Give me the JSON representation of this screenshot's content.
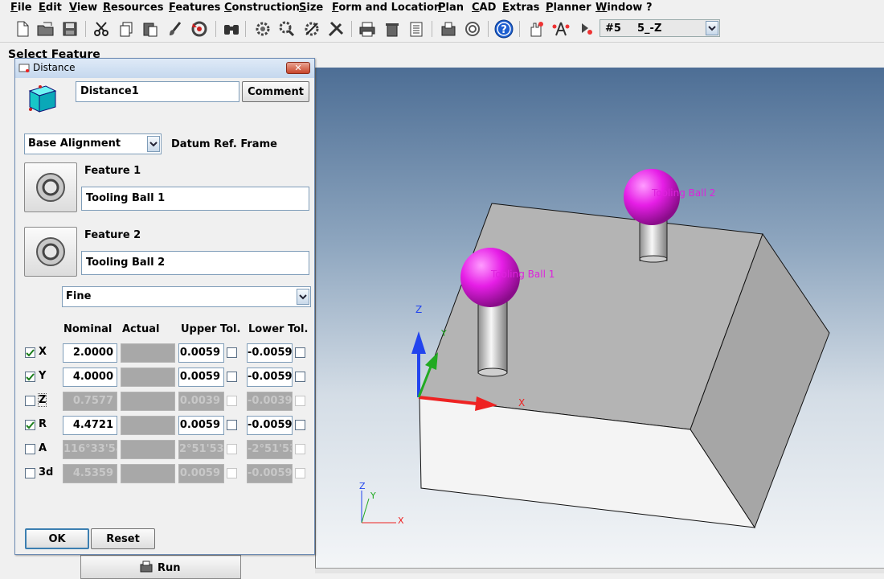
{
  "menu": {
    "items": [
      "File",
      "Edit",
      "View",
      "Resources",
      "Features",
      "Construction",
      "Size",
      "Form and Location",
      "Plan",
      "CAD",
      "Extras",
      "Planner",
      "Window",
      "?"
    ]
  },
  "toolbar": {
    "icons": [
      "new-file-icon",
      "open-folder-icon",
      "save-icon",
      "cut-icon",
      "copy-icon",
      "paste-icon",
      "brush-icon",
      "undo-icon",
      "binoculars-icon",
      "feature-tools-icon",
      "probe-icon",
      "measure-icon",
      "tools-icon",
      "print-icon",
      "delete-icon",
      "report-icon",
      "export-icon",
      "refresh-icon",
      "help-icon",
      "hand-tool-icon",
      "align-tool-icon",
      "rotate-tool-icon"
    ],
    "view_select": {
      "number": "#5",
      "value": "5_-Z"
    }
  },
  "background": {
    "select_feature_label": "Select Feature",
    "run_label": "Run"
  },
  "dialog": {
    "title": "Distance",
    "name_value": "Distance1",
    "comment_label": "Comment",
    "alignment": {
      "selected": "Base Alignment"
    },
    "datum_label": "Datum Ref. Frame",
    "feature1": {
      "label": "Feature 1",
      "value": "Tooling Ball 1"
    },
    "feature2": {
      "label": "Feature 2",
      "value": "Tooling Ball 2"
    },
    "precision": {
      "selected": "Fine"
    },
    "columns": {
      "nominal": "Nominal",
      "actual": "Actual",
      "upper": "Upper Tol.",
      "lower": "Lower Tol."
    },
    "rows": [
      {
        "label": "X",
        "checked": true,
        "nominal": "2.0000",
        "upper": "0.0059",
        "lower": "-0.0059"
      },
      {
        "label": "Y",
        "checked": true,
        "nominal": "4.0000",
        "upper": "0.0059",
        "lower": "-0.0059"
      },
      {
        "label": "Z",
        "checked": false,
        "nominal": "0.7577",
        "upper": "0.0039",
        "lower": "-0.0039"
      },
      {
        "label": "R",
        "checked": true,
        "nominal": "4.4721",
        "upper": "0.0059",
        "lower": "-0.0059"
      },
      {
        "label": "A",
        "checked": false,
        "nominal": "116°33'54",
        "upper": "2°51'53",
        "lower": "-2°51'53"
      },
      {
        "label": "3d",
        "checked": false,
        "nominal": "4.5359",
        "upper": "0.0059",
        "lower": "-0.0059"
      }
    ],
    "ok_label": "OK",
    "reset_label": "Reset"
  },
  "viewport": {
    "ball1_label": "Tooling Ball 1",
    "ball2_label": "Tooling Ball 2",
    "axis_x": "X",
    "axis_y": "Y",
    "axis_z": "Z",
    "colors": {
      "ball": "#e61ee6",
      "label": "#dd22dd",
      "x_axis": "#ee2222",
      "y_axis": "#22aa22",
      "z_axis": "#2244ee"
    }
  }
}
